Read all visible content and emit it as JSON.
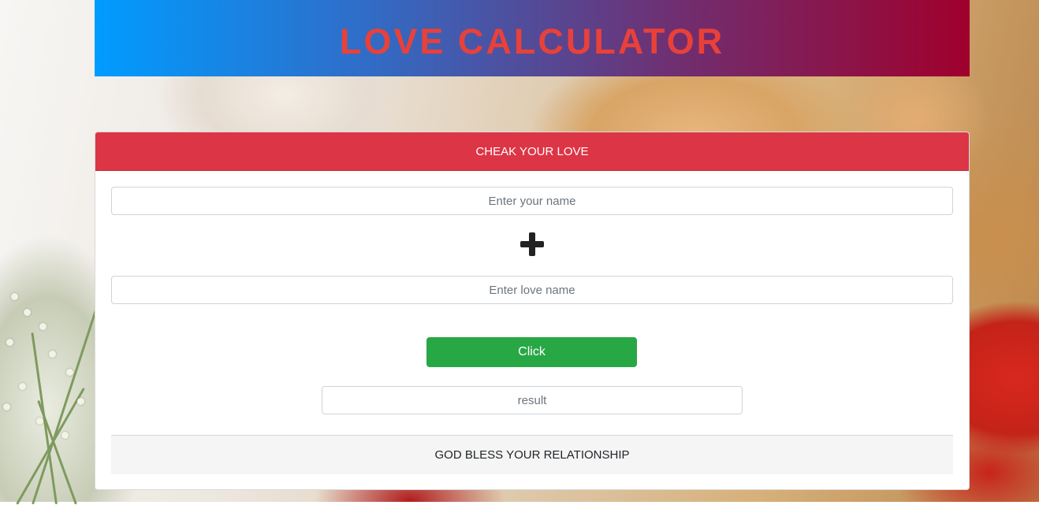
{
  "header": {
    "title": "LOVE CALCULATOR",
    "title_color": "#e8413a",
    "gradient": [
      "#009cff",
      "#a0002c"
    ]
  },
  "card": {
    "header_label": "CHEAK YOUR LOVE",
    "header_color": "#dc3545",
    "your_name": {
      "value": "",
      "placeholder": "Enter your name"
    },
    "plus_icon": "plus-icon",
    "love_name": {
      "value": "",
      "placeholder": "Enter love name"
    },
    "button_label": "Click",
    "button_color": "#28a745",
    "result": {
      "value": "",
      "placeholder": "result"
    },
    "footer_text": "GOD BLESS YOUR RELATIONSHIP"
  }
}
